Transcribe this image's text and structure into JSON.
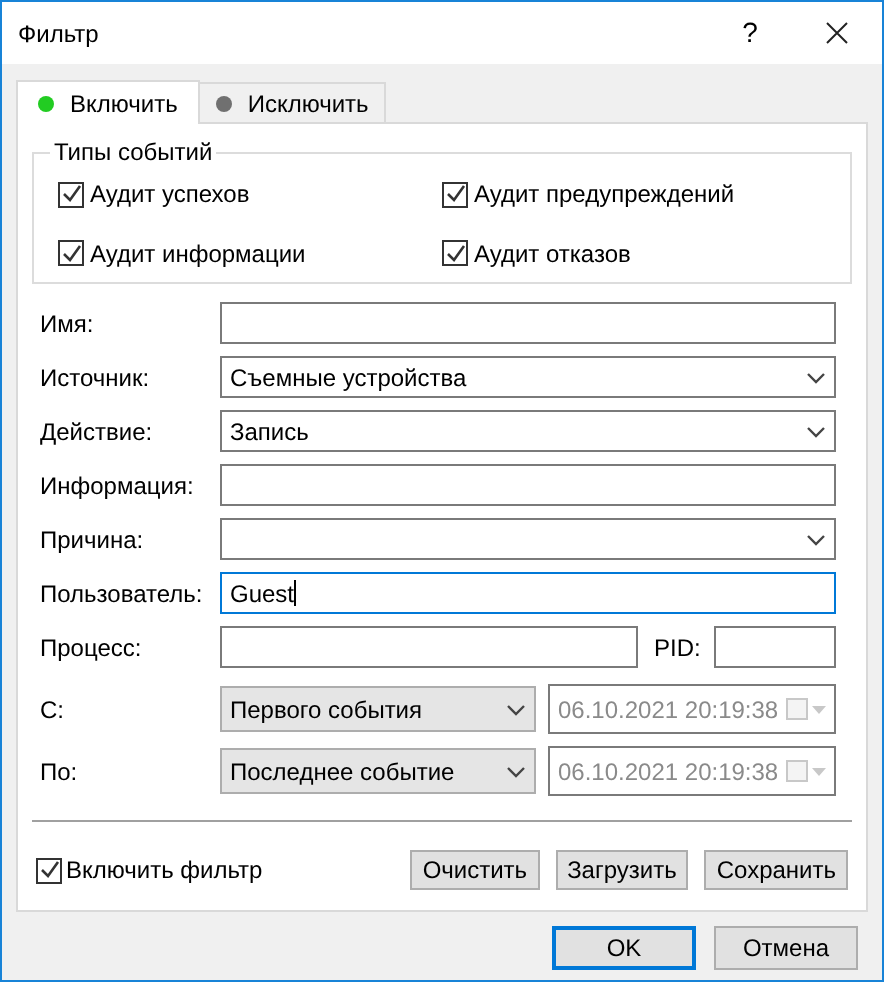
{
  "window": {
    "title": "Фильтр",
    "help": "?"
  },
  "tabs": [
    {
      "label": "Включить",
      "selected": true,
      "color": "#22cc22"
    },
    {
      "label": "Исключить",
      "selected": false,
      "color": "#707070"
    }
  ],
  "event_types": {
    "title": "Типы событий",
    "items": [
      {
        "label": "Аудит успехов",
        "checked": true
      },
      {
        "label": "Аудит предупреждений",
        "checked": true
      },
      {
        "label": "Аудит информации",
        "checked": true
      },
      {
        "label": "Аудит отказов",
        "checked": true
      }
    ]
  },
  "fields": [
    {
      "kind": "text",
      "label": "Имя:",
      "focused": false
    },
    {
      "kind": "combo",
      "label": "Источник:",
      "value": "Съемные устройства",
      "focused": false
    },
    {
      "kind": "combo",
      "label": "Действие:",
      "value": "Запись",
      "focused": false
    },
    {
      "kind": "text",
      "label": "Информация:",
      "focused": false
    },
    {
      "kind": "combo",
      "label": "Причина:",
      "focused": false
    },
    {
      "kind": "text",
      "label": "Пользователь:",
      "value": "Guest",
      "focused": true
    }
  ],
  "process": {
    "label": "Процесс:",
    "pid_label": "PID:"
  },
  "range": [
    {
      "label": "С:",
      "option": "Первого события",
      "datetime": "06.10.2021 20:19:38",
      "checked": false
    },
    {
      "label": "По:",
      "option": "Последнее событие",
      "datetime": "06.10.2021 20:19:38",
      "checked": false
    }
  ],
  "enable_filter": {
    "label": "Включить фильтр",
    "checked": true
  },
  "actions": [
    "Очистить",
    "Загрузить",
    "Сохранить"
  ],
  "buttons": [
    {
      "label": "OK",
      "default": true
    },
    {
      "label": "Отмена",
      "default": false
    }
  ]
}
